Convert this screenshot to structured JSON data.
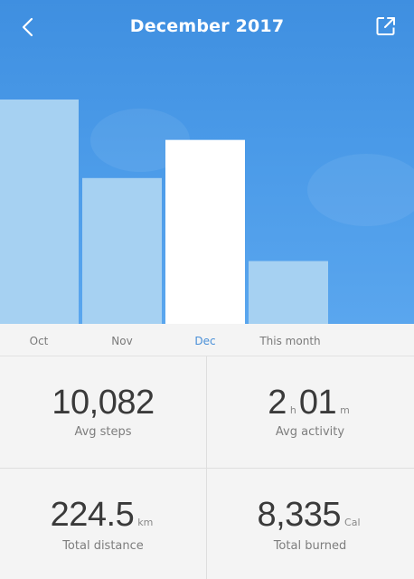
{
  "header": {
    "title": "December 2017"
  },
  "chart_data": {
    "type": "bar",
    "categories": [
      "Oct",
      "Nov",
      "Dec",
      "This month"
    ],
    "selected": "Dec",
    "values": [
      10,
      6.5,
      8.2,
      2.8
    ],
    "colors": {
      "bar": "#a6d1f2",
      "selected_bar": "#ffffff"
    }
  },
  "tabs": [
    {
      "label": "Oct"
    },
    {
      "label": "Nov"
    },
    {
      "label": "Dec",
      "active": true
    },
    {
      "label": "This month"
    }
  ],
  "stats": {
    "steps": {
      "value": "10,082",
      "label": "Avg steps"
    },
    "activity": {
      "hours": "2",
      "hours_unit": "h",
      "minutes": "01",
      "minutes_unit": "m",
      "label": "Avg activity"
    },
    "distance": {
      "value": "224.5",
      "unit": "km",
      "label": "Total distance"
    },
    "burned": {
      "value": "8,335",
      "unit": "Cal",
      "label": "Total burned"
    }
  },
  "colors": {
    "header_top": "#3f8fe0",
    "accent": "#4a90d8"
  },
  "icons": {
    "back": "chevron-left-icon",
    "share": "share-icon"
  }
}
